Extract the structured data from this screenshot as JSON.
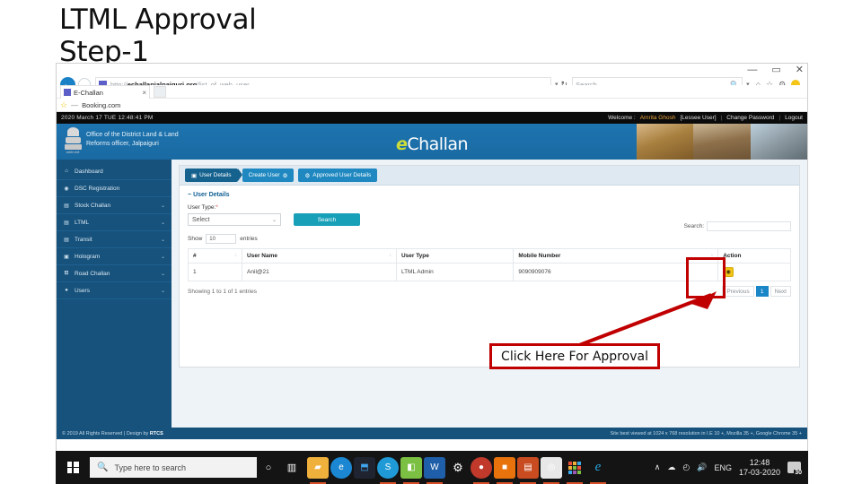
{
  "slide": {
    "title": "LTML Approval\nStep-1"
  },
  "browser": {
    "url_prefix": "http://",
    "url_host": "echallanjalpaiguri.org",
    "url_path": "/list_of_web_user",
    "tab_label": "E-Challan",
    "tab_close": "×",
    "newtab_label": "⬜",
    "search_placeholder": "Search...",
    "search_icon": "🔍",
    "back_icon": "←",
    "forward_icon": "→",
    "reload_icon": "↻",
    "caret_icon": "▾",
    "home_icon": "⌂",
    "favorites_icon": "☆",
    "settings_icon": "⚙",
    "minimize": "—",
    "maximize": "▭",
    "close": "✕",
    "bookmark_label": "Booking.com",
    "bookmark_dash": "—"
  },
  "topbar": {
    "datetime": "2020 March 17 TUE  12:48:41 PM",
    "welcome_prefix": "Welcome :",
    "user_name": "Amrita Ghosh",
    "user_role": "[Lessee User]",
    "change_password": "Change Password",
    "logout": "Logout",
    "separator": "|"
  },
  "header": {
    "org_name": "Office of the District Land & Land\nReforms officer, Jalpaiguri",
    "logo_e": "e",
    "logo_rest": "Challan",
    "emblem_text": "सत्यमेव जयते"
  },
  "sidebar": {
    "items": [
      {
        "label": "Dashboard",
        "icon": "⌂",
        "icon_name": "home-icon",
        "caret": ""
      },
      {
        "label": "DSC Registration",
        "icon": "◉",
        "icon_name": "dsc-icon",
        "caret": ""
      },
      {
        "label": "Stock Challan",
        "icon": "▤",
        "icon_name": "stock-icon",
        "caret": "⌄"
      },
      {
        "label": "LTML",
        "icon": "▤",
        "icon_name": "ltml-icon",
        "caret": "⌄"
      },
      {
        "label": "Transit",
        "icon": "▤",
        "icon_name": "transit-icon",
        "caret": "⌄"
      },
      {
        "label": "Hologram",
        "icon": "▣",
        "icon_name": "hologram-icon",
        "caret": "⌄"
      },
      {
        "label": "Road Challan",
        "icon": "⛾",
        "icon_name": "road-challan-icon",
        "caret": "⌄"
      },
      {
        "label": "Users",
        "icon": "●",
        "icon_name": "users-icon",
        "caret": "⌄"
      }
    ]
  },
  "tabs": [
    {
      "label": "User Details",
      "icon": "▣",
      "icon_name": "monitor-icon",
      "icon_pos": "left",
      "active": true
    },
    {
      "label": "Create User",
      "icon": "⚙",
      "icon_name": "gear-icon",
      "icon_pos": "right",
      "active": false
    },
    {
      "label": "Approved User Details",
      "icon": "⚙",
      "icon_name": "gear-icon",
      "icon_pos": "left",
      "active": false
    }
  ],
  "form": {
    "legend": "User Details",
    "legend_minus": "−",
    "user_type_label": "User Type:",
    "required_mark": "*",
    "user_type_value": "Select",
    "select_caret": "⌄",
    "search_button": "Search"
  },
  "table": {
    "show_label": "Show",
    "show_value": "10",
    "entries_label": "entries",
    "search_label": "Search:",
    "search_value": "",
    "sort_icon": "↕",
    "columns": [
      "#",
      "User Name",
      "User Type",
      "Mobile Number",
      "Action"
    ],
    "rows": [
      {
        "index": "1",
        "user_name": "Anil@21",
        "user_type": "LTML Admin",
        "mobile": "9090909076",
        "action_icon": "◉",
        "action_icon_name": "eye-icon"
      }
    ],
    "showing_text": "Showing 1 to 1 of 1 entries",
    "pagination": {
      "previous": "Previous",
      "pages": [
        "1"
      ],
      "next": "Next"
    }
  },
  "page_footer": {
    "copyright": "© 2019  All Rights Reserved | Design by ",
    "designer": "RTCS",
    "best_viewed": "Site best viewed at 1024 x 768 resolution in I.E 10 +, Mozilla 35 +, Google Chrome 35 +"
  },
  "annotation": {
    "callout_text": "Click Here For Approval",
    "accent_color": "#c00000"
  },
  "taskbar": {
    "search_placeholder": "Type here to search",
    "search_icon": "🔍",
    "cortana_icon": "○",
    "taskview_icon": "▥",
    "apps": [
      {
        "name": "file-explorer-icon",
        "glyph": "▰",
        "cls": "a-folder",
        "running": true
      },
      {
        "name": "edge-icon",
        "glyph": "e",
        "cls": "a-edge",
        "running": false
      },
      {
        "name": "vscode-icon",
        "glyph": "⬒",
        "cls": "a-vs",
        "running": false
      },
      {
        "name": "skype-icon",
        "glyph": "S",
        "cls": "a-blue",
        "running": true
      },
      {
        "name": "excel-icon",
        "glyph": "◧",
        "cls": "a-green",
        "running": true
      },
      {
        "name": "word-icon",
        "glyph": "W",
        "cls": "a-ppt2",
        "running": true
      },
      {
        "name": "settings-icon",
        "glyph": "⚙",
        "cls": "a-gear",
        "running": false
      },
      {
        "name": "pdf-reader-icon",
        "glyph": "●",
        "cls": "a-pdf",
        "running": true
      },
      {
        "name": "powerpoint-icon",
        "glyph": "■",
        "cls": "a-orange",
        "running": true
      },
      {
        "name": "presentation-icon",
        "glyph": "▤",
        "cls": "a-ppt",
        "running": true
      },
      {
        "name": "chrome-icon",
        "glyph": "◎",
        "cls": "a-chrome",
        "running": true
      },
      {
        "name": "apps-grid-icon",
        "glyph": "",
        "cls": "a-grid",
        "running": true
      },
      {
        "name": "internet-explorer-icon",
        "glyph": "e",
        "cls": "a-ie",
        "running": true
      }
    ],
    "tray": {
      "chevron": "∧",
      "onedrive_icon": "☁",
      "network_icon": "◴",
      "volume_icon": "🔊",
      "language": "ENG",
      "time": "12:48",
      "date": "17-03-2020",
      "notification_count": "30"
    }
  }
}
